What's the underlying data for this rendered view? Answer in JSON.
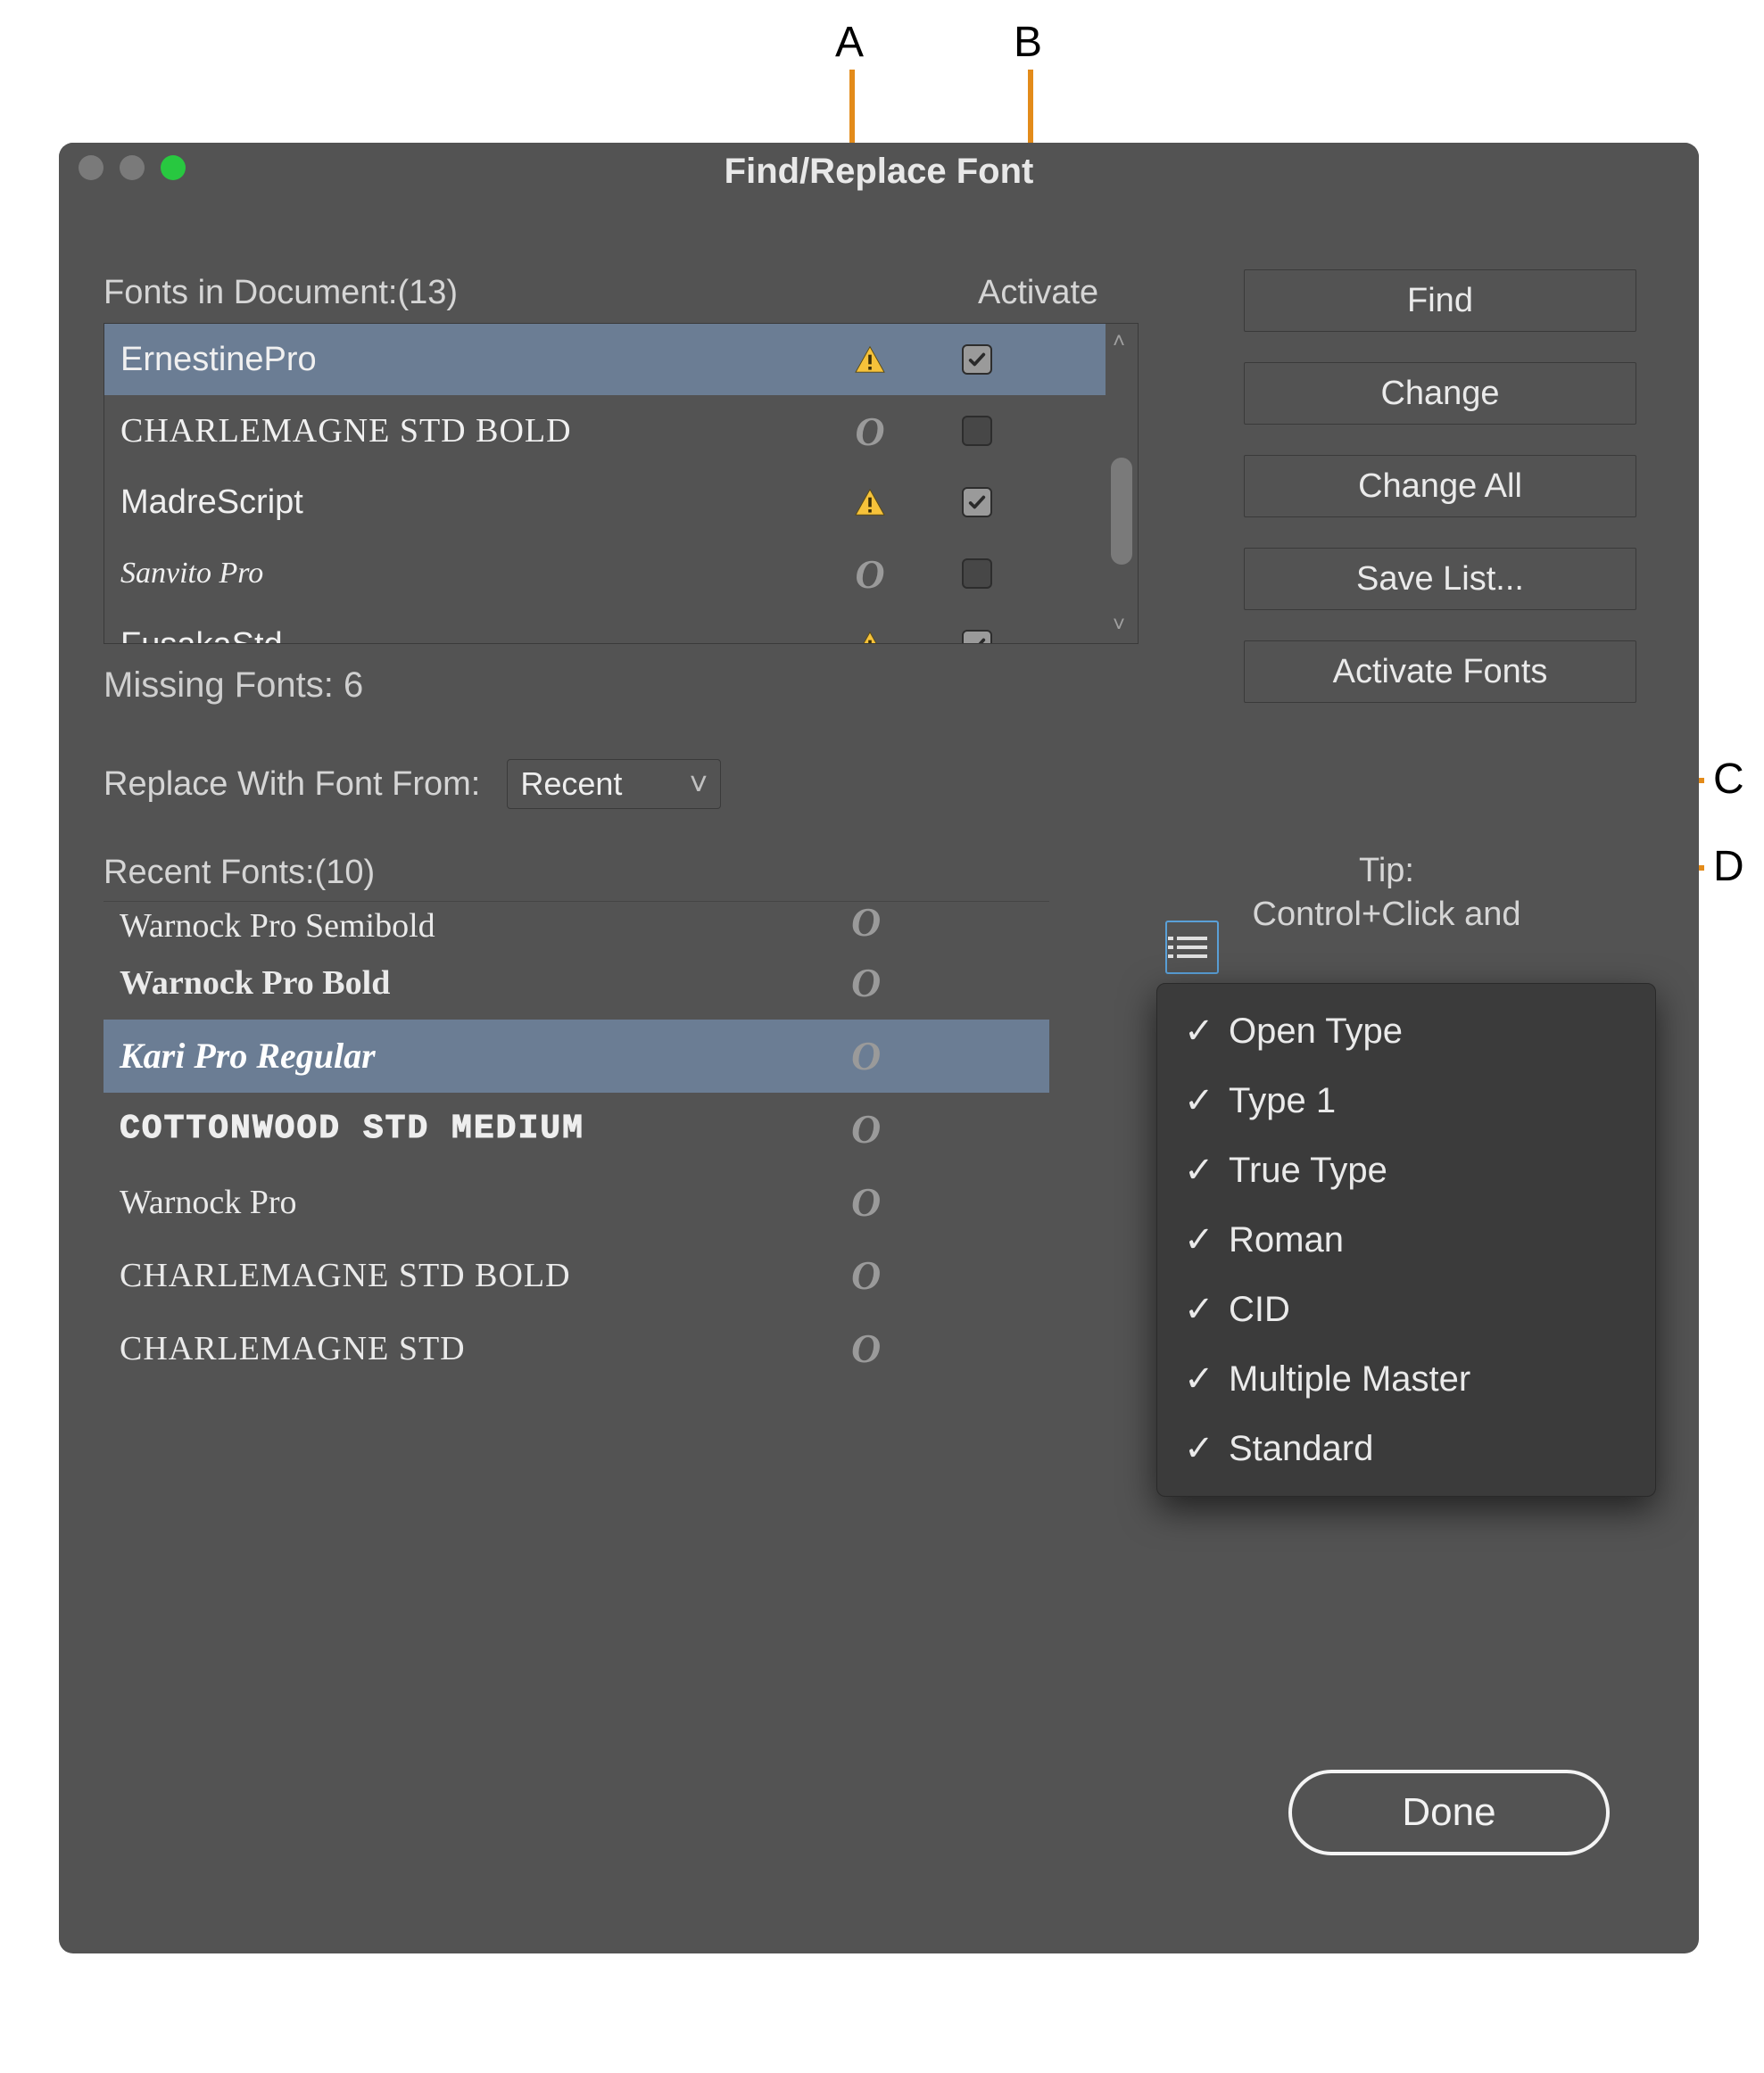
{
  "window": {
    "title": "Find/Replace Font"
  },
  "fontsInDoc": {
    "label": "Fonts in Document:",
    "count": "(13)",
    "activateHeader": "Activate",
    "rows": [
      {
        "name": "ErnestinePro",
        "missing": true,
        "checked": true,
        "selected": true,
        "cls": ""
      },
      {
        "name": "CHARLEMAGNE STD BOLD",
        "missing": false,
        "checked": false,
        "selected": false,
        "cls": "smallcaps serif"
      },
      {
        "name": "MadreScript",
        "missing": true,
        "checked": true,
        "selected": false,
        "cls": ""
      },
      {
        "name": "Sanvito Pro",
        "missing": false,
        "checked": false,
        "selected": false,
        "cls": "italic"
      },
      {
        "name": "FusakaStd",
        "missing": true,
        "checked": true,
        "selected": false,
        "cls": ""
      }
    ]
  },
  "missing": {
    "label": "Missing Fonts: 6"
  },
  "replace": {
    "label": "Replace With Font From:",
    "value": "Recent"
  },
  "recent": {
    "label": "Recent Fonts:",
    "count": "(10)",
    "rows": [
      {
        "name": "Warnock Pro Semibold",
        "selected": false,
        "cls": "serif",
        "cut": true
      },
      {
        "name": "Warnock Pro Bold",
        "selected": false,
        "cls": "bold serif"
      },
      {
        "name": "Kari Pro Regular",
        "selected": true,
        "cls": "karipro"
      },
      {
        "name": "COTTONWOOD STD MEDIUM",
        "selected": false,
        "cls": "decor"
      },
      {
        "name": "Warnock Pro",
        "selected": false,
        "cls": "serif"
      },
      {
        "name": "CHARLEMAGNE STD BOLD",
        "selected": false,
        "cls": "smallcaps serif"
      },
      {
        "name": "CHARLEMAGNE STD",
        "selected": false,
        "cls": "smallcaps serif"
      }
    ]
  },
  "buttons": {
    "find": "Find",
    "change": "Change",
    "changeAll": "Change All",
    "saveList": "Save List...",
    "activateFonts": "Activate Fonts",
    "done": "Done"
  },
  "tip": {
    "line1": "Tip:",
    "line2": "Control+Click and"
  },
  "popup": {
    "items": [
      {
        "label": "Open Type",
        "checked": true
      },
      {
        "label": "Type 1",
        "checked": true
      },
      {
        "label": "True Type",
        "checked": true
      },
      {
        "label": "Roman",
        "checked": true
      },
      {
        "label": "CID",
        "checked": true
      },
      {
        "label": "Multiple Master",
        "checked": true
      },
      {
        "label": "Standard",
        "checked": true
      }
    ]
  },
  "callouts": {
    "A": "A",
    "B": "B",
    "C": "C",
    "D": "D"
  }
}
